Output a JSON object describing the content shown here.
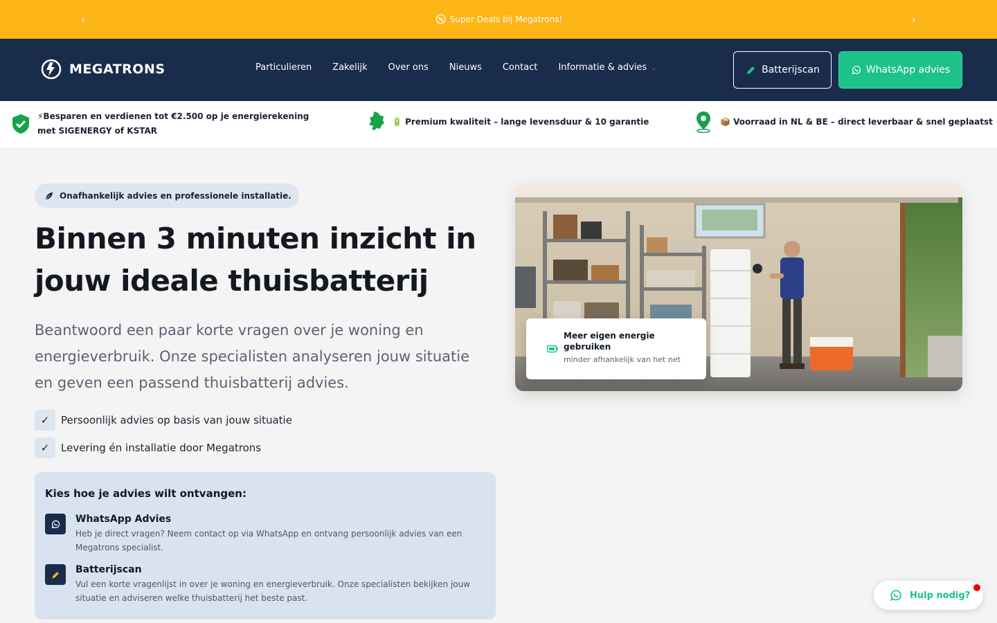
{
  "announcement": {
    "message": "Super Deals bij Megatrons!",
    "prev_icon": "chevron-left-icon",
    "next_icon": "chevron-right-icon"
  },
  "header": {
    "logo_text": "MEGATRONS",
    "nav": [
      {
        "label": "Particulieren"
      },
      {
        "label": "Zakelijk"
      },
      {
        "label": "Over ons"
      },
      {
        "label": "Nieuws"
      },
      {
        "label": "Contact"
      },
      {
        "label": "Informatie & advies"
      }
    ],
    "scan_button": "Batterijscan",
    "whatsapp_button": "WhatsApp advies"
  },
  "usps": [
    {
      "text": "⚡Besparen en verdienen tot €2.500 op je energierekening met SIGENERGY of KSTAR",
      "icon": "shield-check-icon"
    },
    {
      "text": "🔋 Premium kwaliteit – lange levensduur & 10 garantie",
      "icon": "netherlands-map-icon"
    },
    {
      "text": "📦 Voorraad in NL & BE – direct leverbaar & snel geplaatst",
      "icon": "location-pin-icon"
    }
  ],
  "hero": {
    "pill": "Onafhankelijk advies en professionele installatie.",
    "title": "Binnen 3 minuten inzicht in jouw ideale thuisbatterij",
    "lead": "Beantwoord een paar korte vragen over je woning en energieverbruik. Onze specialisten analyseren jouw situatie en geven een passend thuisbatterij advies.",
    "checks": [
      {
        "label": "Persoonlijk advies op basis van jouw situatie"
      },
      {
        "label": "Levering én installatie door Megatrons"
      }
    ],
    "choose": {
      "title": "Kies hoe je advies wilt ontvangen:",
      "options": [
        {
          "title": "WhatsApp Advies",
          "desc": "Heb je direct vragen? Neem contact op via WhatsApp en ontvang persoonlijk advies van een Megatrons specialist.",
          "icon": "whatsapp-icon"
        },
        {
          "title": "Batterijscan",
          "desc": "Vul een korte vragenlijst in over je woning en energieverbruik. Onze specialisten bekijken jouw situatie en adviseren welke thuisbatterij het beste past.",
          "icon": "pencil-icon"
        }
      ]
    },
    "image_card": {
      "title": "Meer eigen energie gebruiken",
      "subtitle": "minder afhankelijk van het net"
    }
  },
  "help_widget": {
    "label": "Hulp nodig?"
  },
  "colors": {
    "accent_yellow": "#fdb515",
    "navy": "#192c4b",
    "whatsapp_green": "#1dc18a",
    "usp_green": "#16a34a"
  }
}
